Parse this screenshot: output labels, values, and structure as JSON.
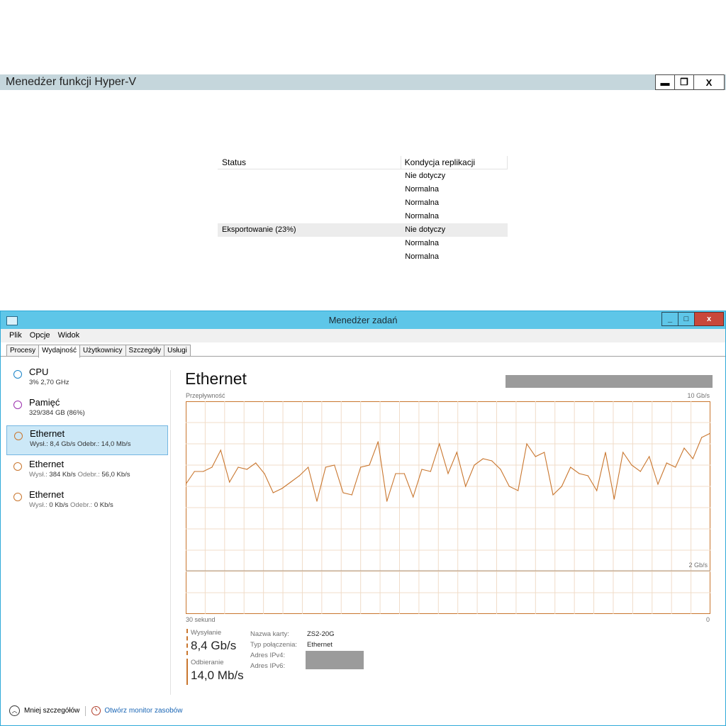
{
  "hyperv": {
    "title": "Menedżer funkcji Hyper-V",
    "controls": {
      "minimize": "▬",
      "restore": "❐",
      "close": "X"
    },
    "columns": [
      "Status",
      "Kondycja replikacji"
    ],
    "rows": [
      {
        "status": "",
        "health": "Nie dotyczy"
      },
      {
        "status": "",
        "health": "Normalna"
      },
      {
        "status": "",
        "health": "Normalna"
      },
      {
        "status": "",
        "health": "Normalna"
      },
      {
        "status": "Eksportowanie (23%)",
        "health": "Nie dotyczy"
      },
      {
        "status": "",
        "health": "Normalna"
      },
      {
        "status": "",
        "health": "Normalna"
      }
    ]
  },
  "taskmgr": {
    "title": "Menedżer zadań",
    "controls": {
      "minimize": "_",
      "restore": "□",
      "close": "x"
    },
    "menu": [
      "Plik",
      "Opcje",
      "Widok"
    ],
    "tabs": [
      "Procesy",
      "Wydajność",
      "Użytkownicy",
      "Szczegóły",
      "Usługi"
    ],
    "active_tab": "Wydajność",
    "sidebar": [
      {
        "name": "CPU",
        "sub": "3% 2,70 GHz",
        "color": "#1b84c8"
      },
      {
        "name": "Pamięć",
        "sub": "329/384 GB (86%)",
        "color": "#9b2fae"
      },
      {
        "name": "Ethernet",
        "sub_send_label": "Wysł.:",
        "sub_send": "8,4 Gb/s",
        "sub_recv_label": "Odebr.:",
        "sub_recv": "14,0 Mb/s",
        "color": "#c9762e"
      },
      {
        "name": "Ethernet",
        "sub_send_label": "Wysł.:",
        "sub_send": "384 Kb/s",
        "sub_recv_label": "Odebr.:",
        "sub_recv": "56,0 Kb/s",
        "color": "#c9762e"
      },
      {
        "name": "Ethernet",
        "sub_send_label": "Wysł.:",
        "sub_send": "0 Kb/s",
        "sub_recv_label": "Odebr.:",
        "sub_recv": "0 Kb/s",
        "color": "#c9762e"
      }
    ],
    "main": {
      "title": "Ethernet",
      "axis_label": "Przepływność",
      "axis_max": "10 Gb/s",
      "axis_mid": "2 Gb/s",
      "time_left": "30 sekund",
      "time_right": "0",
      "send_label": "Wysyłanie",
      "send_value": "8,4 Gb/s",
      "recv_label": "Odbieranie",
      "recv_value": "14,0 Mb/s",
      "props": [
        {
          "k": "Nazwa karty:",
          "v": "ZS2-20G"
        },
        {
          "k": "Typ połączenia:",
          "v": "Ethernet"
        },
        {
          "k": "Adres IPv4:",
          "v": ""
        },
        {
          "k": "Adres IPv6:",
          "v": ""
        }
      ]
    },
    "footer": {
      "less": "Mniej szczegółów",
      "monitor": "Otwórz monitor zasobów"
    },
    "colors": {
      "accent": "#c9762e",
      "titlebar": "#5ec6e8",
      "grid": "#f0dcc8"
    }
  },
  "chart_data": {
    "type": "line",
    "xlabel": "",
    "ylabel": "Przepływność",
    "x_range": [
      30,
      0
    ],
    "ylim": [
      0,
      10
    ],
    "series": [
      {
        "name": "Wysyłanie",
        "values": [
          6.1,
          6.7,
          6.7,
          6.9,
          7.7,
          6.2,
          6.9,
          6.8,
          7.1,
          6.6,
          5.7,
          5.9,
          6.2,
          6.5,
          6.9,
          5.3,
          6.9,
          7.0,
          5.7,
          5.6,
          6.9,
          7.0,
          8.1,
          5.3,
          6.6,
          6.6,
          5.5,
          6.8,
          6.7,
          8.0,
          6.6,
          7.6,
          6.0,
          7.0,
          7.3,
          7.2,
          6.8,
          6.0,
          5.8,
          8.0,
          7.4,
          7.6,
          5.6,
          6.0,
          6.9,
          6.6,
          6.5,
          5.8,
          7.6,
          5.4,
          7.6,
          7.0,
          6.7,
          7.4,
          6.1,
          7.1,
          6.9,
          7.8,
          7.3,
          8.3,
          8.5
        ]
      }
    ]
  }
}
